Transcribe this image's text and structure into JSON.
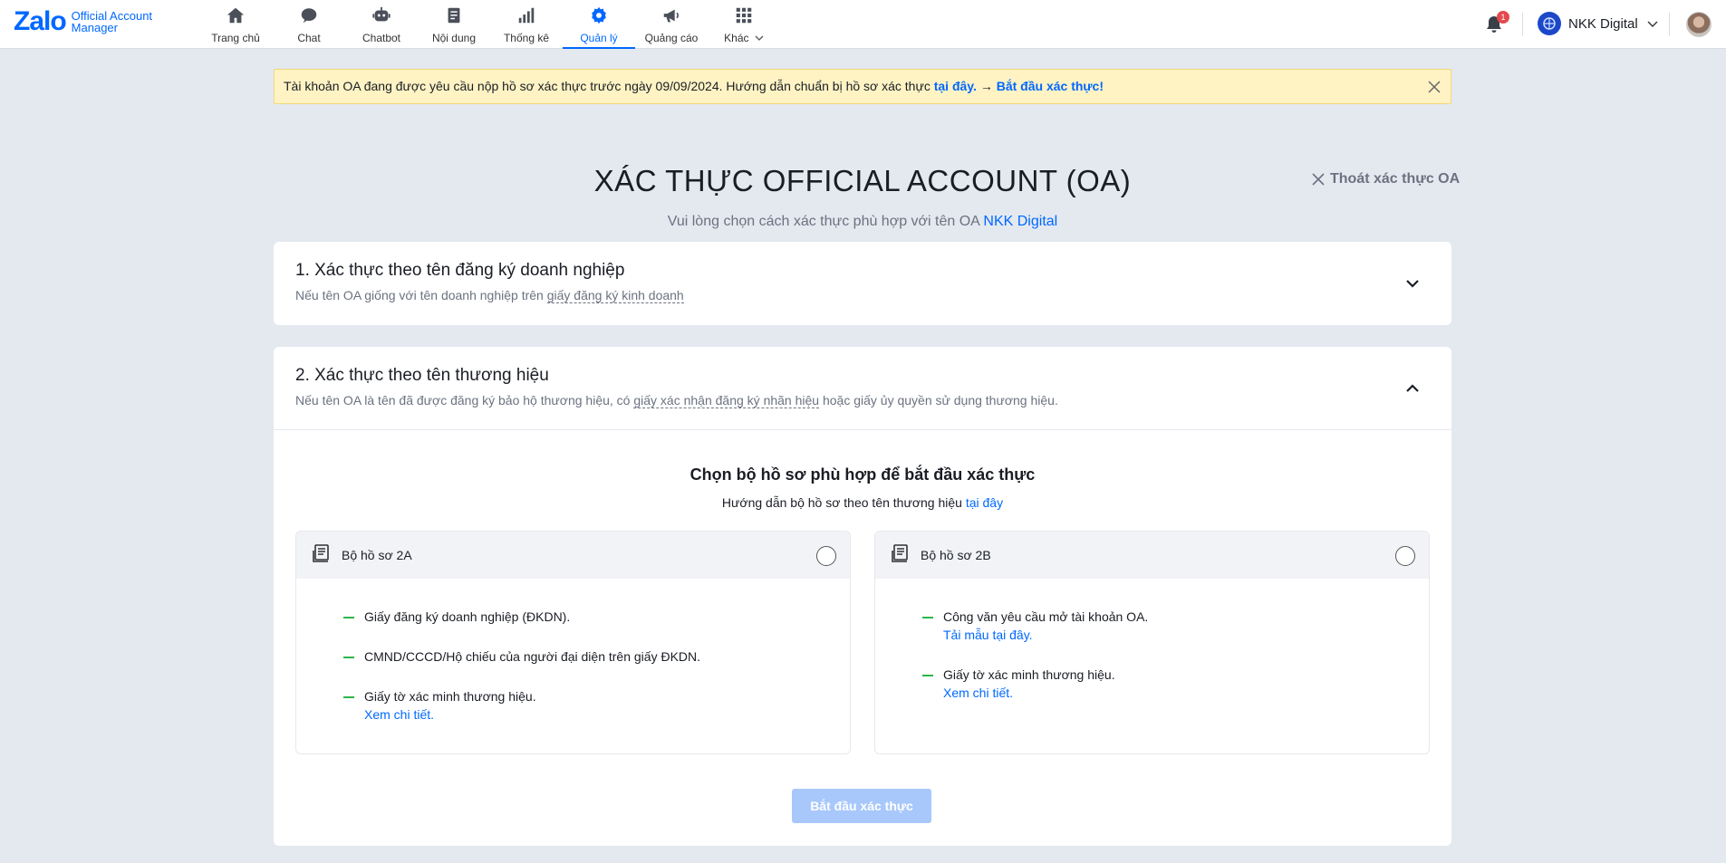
{
  "topbar": {
    "logo": {
      "word": "Zalo",
      "line1": "Official Account",
      "line2": "Manager"
    },
    "nav": [
      {
        "label": "Trang chủ",
        "icon": "home-icon"
      },
      {
        "label": "Chat",
        "icon": "chat-icon"
      },
      {
        "label": "Chatbot",
        "icon": "robot-icon"
      },
      {
        "label": "Nội dung",
        "icon": "document-icon"
      },
      {
        "label": "Thống kê",
        "icon": "bar-chart-icon"
      },
      {
        "label": "Quản lý",
        "icon": "gear-icon",
        "active": true
      },
      {
        "label": "Quảng cáo",
        "icon": "megaphone-icon"
      },
      {
        "label": "Khác",
        "icon": "grid-icon"
      }
    ],
    "notification_count": "1",
    "account_name": "NKK Digital"
  },
  "notice": {
    "text": "Tài khoản OA đang được yêu cầu nộp hồ sơ xác thực trước ngày 09/09/2024. Hướng dẫn chuẩn bị hồ sơ xác thực ",
    "link1": "tại đây.",
    "arrow": " → ",
    "link2": "Bắt đầu xác thực!"
  },
  "page": {
    "title": "XÁC THỰC OFFICIAL ACCOUNT (OA)",
    "exit_label": "Thoát xác thực OA",
    "subtitle_prefix": "Vui lòng chọn cách xác thực phù hợp với tên OA ",
    "subtitle_name": "NKK Digital"
  },
  "method1": {
    "title": "1. Xác thực theo tên đăng ký doanh nghiệp",
    "desc_prefix": "Nếu tên OA giống với tên doanh nghiệp trên ",
    "desc_term": "giấy đăng ký kinh doanh"
  },
  "method2": {
    "title": "2. Xác thực theo tên thương hiệu",
    "desc_prefix": "Nếu tên OA là tên đã được đăng ký bảo hộ thương hiệu, có ",
    "desc_term": "giấy xác nhận đăng ký nhãn hiệu",
    "desc_suffix": " hoặc giấy ủy quyền sử dụng thương hiệu.",
    "choose_title": "Chọn bộ hồ sơ phù hợp để bắt đầu xác thực",
    "choose_sub_prefix": "Hướng dẫn bộ hồ sơ theo tên thương hiệu ",
    "choose_sub_link": "tại đây",
    "option_a": {
      "name": "Bộ hồ sơ 2A",
      "items": [
        {
          "text": "Giấy đăng ký doanh nghiệp (ĐKDN).",
          "link": ""
        },
        {
          "text": "CMND/CCCD/Hộ chiếu của người đại diện trên giấy ĐKDN.",
          "link": ""
        },
        {
          "text": "Giấy tờ xác minh thương hiệu.",
          "link": "Xem chi tiết."
        }
      ]
    },
    "option_b": {
      "name": "Bộ hồ sơ 2B",
      "items": [
        {
          "text": "Công văn yêu cầu mở tài khoản OA.",
          "link": "Tải mẫu tại đây."
        },
        {
          "text": "Giấy tờ xác minh thương hiệu.",
          "link": "Xem chi tiết."
        }
      ]
    },
    "start_button": "Bắt đầu xác thực"
  },
  "colors": {
    "accent": "#0068ff",
    "bullet": "#2fb54a",
    "notice_bg": "#fff3c4",
    "disabled_button": "#a8c8fb"
  }
}
